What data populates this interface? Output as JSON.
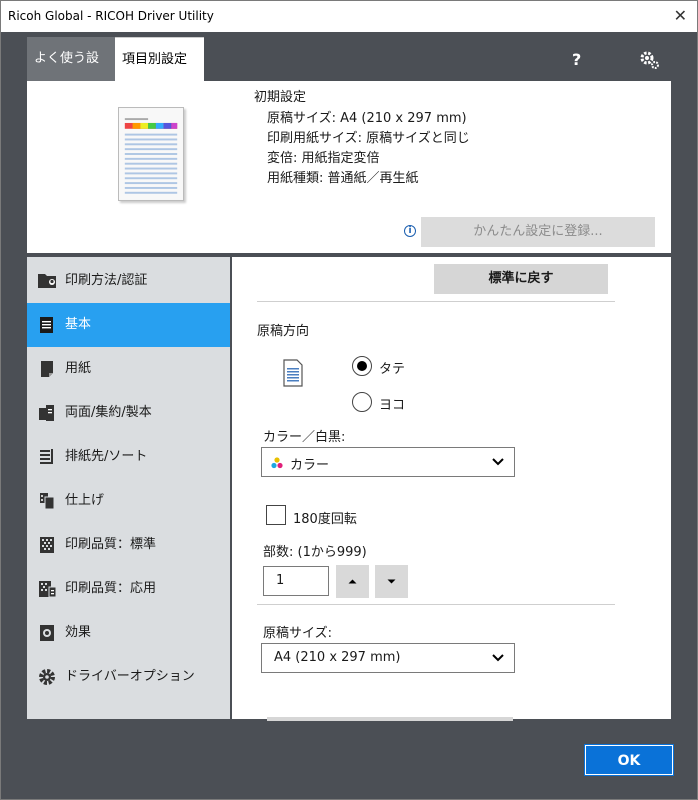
{
  "window": {
    "title": "Ricoh Global - RICOH Driver Utility",
    "close_glyph": "✕"
  },
  "tabs": {
    "favorites": "よく使う設定",
    "by_category": "項目別設定"
  },
  "toolbar": {
    "help_glyph": "?"
  },
  "summary": {
    "title": "初期設定",
    "lines": [
      "原稿サイズ:  A4 (210 x 297 mm)",
      "印刷用紙サイズ:  原稿サイズと同じ",
      "変倍:  用紙指定変倍",
      "用紙種類:  普通紙／再生紙"
    ],
    "info_glyph": "i",
    "register_label": "かんたん設定に登録..."
  },
  "sidebar": {
    "items": [
      {
        "label": "印刷方法/認証",
        "icon": "folder-user-icon"
      },
      {
        "label": "基本",
        "icon": "document-icon"
      },
      {
        "label": "用紙",
        "icon": "paper-icon"
      },
      {
        "label": "両面/集約/製本",
        "icon": "duplex-icon"
      },
      {
        "label": "排紙先/ソート",
        "icon": "output-tray-icon"
      },
      {
        "label": "仕上げ",
        "icon": "finishing-icon"
      },
      {
        "label": "印刷品質：標準",
        "icon": "quality-standard-icon"
      },
      {
        "label": "印刷品質：応用",
        "icon": "quality-advanced-icon"
      },
      {
        "label": "効果",
        "icon": "effect-icon"
      },
      {
        "label": "ドライバーオプション",
        "icon": "gear-icon"
      }
    ],
    "active_index": 1
  },
  "content": {
    "reset_label": "標準に戻す",
    "orientation": {
      "label": "原稿方向",
      "portrait": "タテ",
      "landscape": "ヨコ",
      "selected": "portrait"
    },
    "color": {
      "label": "カラー／白黒:",
      "value": "カラー"
    },
    "rotate": {
      "label": "180度回転",
      "checked": false
    },
    "copies": {
      "label": "部数: (1から999)",
      "value": "1"
    },
    "paper_size": {
      "label": "原稿サイズ:",
      "value": "A4 (210 x 297 mm)"
    }
  },
  "footer": {
    "ok_label": "OK"
  },
  "colors": {
    "accent": "#28a0f0",
    "ok": "#0a72d8",
    "frame": "#4b4f55",
    "sidebar": "#dadde0"
  }
}
